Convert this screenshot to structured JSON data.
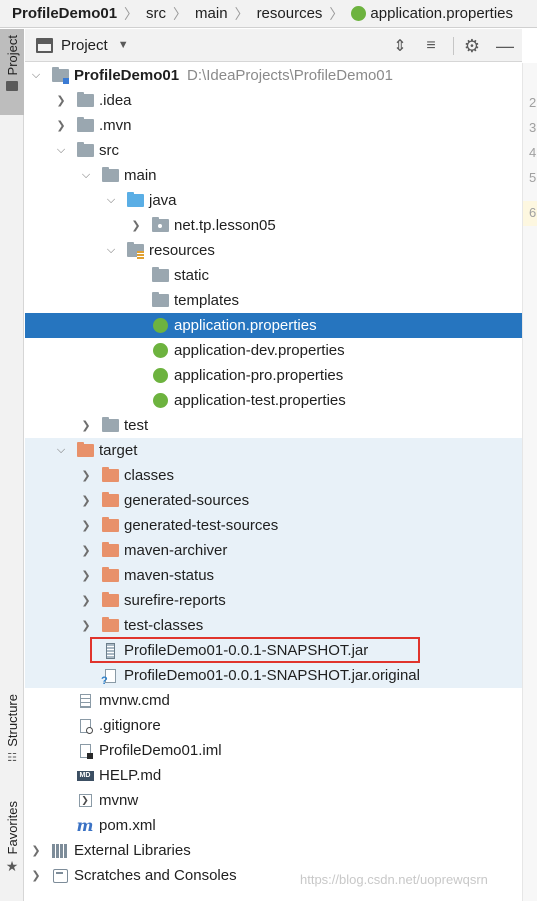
{
  "breadcrumb": {
    "items": [
      "ProfileDemo01",
      "src",
      "main",
      "resources",
      "application.properties"
    ]
  },
  "left_strip": {
    "project_tab": "Project",
    "structure_tab": "Structure",
    "favorites_tab": "Favorites"
  },
  "panel": {
    "title": "Project",
    "icons": [
      "collapse-all-icon",
      "expand-all-icon",
      "gear-icon",
      "minimize-icon"
    ]
  },
  "tree": {
    "root_name": "ProfileDemo01",
    "root_path": "D:\\IdeaProjects\\ProfileDemo01",
    "idea": ".idea",
    "mvn": ".mvn",
    "src": "src",
    "main": "main",
    "java": "java",
    "package": "net.tp.lesson05",
    "resources": "resources",
    "static": "static",
    "templates": "templates",
    "app_props": "application.properties",
    "app_dev": "application-dev.properties",
    "app_pro": "application-pro.properties",
    "app_test": "application-test.properties",
    "test": "test",
    "target": "target",
    "classes": "classes",
    "generated_sources": "generated-sources",
    "generated_test_sources": "generated-test-sources",
    "maven_archiver": "maven-archiver",
    "maven_status": "maven-status",
    "surefire_reports": "surefire-reports",
    "test_classes": "test-classes",
    "jar": "ProfileDemo01-0.0.1-SNAPSHOT.jar",
    "jar_original": "ProfileDemo01-0.0.1-SNAPSHOT.jar.original",
    "mvnw_cmd": "mvnw.cmd",
    "gitignore": ".gitignore",
    "iml": "ProfileDemo01.iml",
    "help": "HELP.md",
    "mvnw": "mvnw",
    "pom": "pom.xml",
    "external_libraries": "External Libraries",
    "scratches": "Scratches and Consoles"
  },
  "gutter": {
    "line_numbers": [
      "2",
      "3",
      "4",
      "5",
      "6"
    ]
  },
  "watermark": "https://blog.csdn.net/uoprewqsrn",
  "colors": {
    "selection": "#2675bf",
    "excluded_bg": "#e8f1f8",
    "highlight_box": "#e0342c",
    "folder_gray": "#9aa7b0",
    "folder_orange": "#e8916a",
    "folder_blue": "#5aaee5"
  }
}
